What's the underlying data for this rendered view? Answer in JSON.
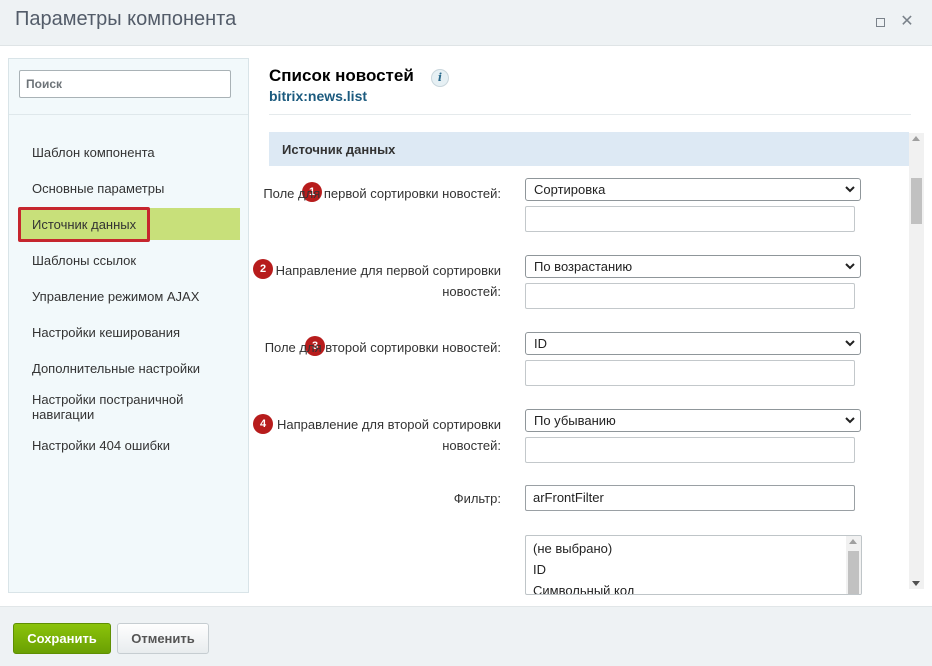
{
  "window": {
    "title": "Параметры компонента"
  },
  "sidebar": {
    "search_placeholder": "Поиск",
    "items": [
      {
        "label": "Шаблон компонента"
      },
      {
        "label": "Основные параметры"
      },
      {
        "label": "Источник данных",
        "active": true
      },
      {
        "label": "Шаблоны ссылок"
      },
      {
        "label": "Управление режимом AJAX"
      },
      {
        "label": "Настройки кеширования"
      },
      {
        "label": "Дополнительные настройки"
      },
      {
        "label": "Настройки постраничной навигации"
      },
      {
        "label": "Настройки 404 ошибки"
      }
    ]
  },
  "component": {
    "title": "Список новостей",
    "code": "bitrix:news.list",
    "info_icon": "info-icon"
  },
  "section": {
    "title": "Источник данных"
  },
  "fields": [
    {
      "badge": "1",
      "label": "Поле для первой сортировки новостей:",
      "select_value": "Сортировка",
      "text_value": ""
    },
    {
      "badge": "2",
      "label": "Направление для первой сортировки новостей:",
      "select_value": "По возрастанию",
      "text_value": ""
    },
    {
      "badge": "3",
      "label": "Поле для второй сортировки новостей:",
      "select_value": "ID",
      "text_value": ""
    },
    {
      "badge": "4",
      "label": "Направление для второй сортировки новостей:",
      "select_value": "По убыванию",
      "text_value": ""
    }
  ],
  "filter": {
    "label": "Фильтр:",
    "value": "arFrontFilter"
  },
  "multi_select": {
    "options": [
      "(не выбрано)",
      "ID",
      "Символьный код"
    ]
  },
  "footer": {
    "save_label": "Сохранить",
    "cancel_label": "Отменить"
  },
  "colors": {
    "active_nav": "#c8e07a",
    "highlight_frame": "#c6262e",
    "badge": "#b71c1c",
    "section_header": "#dde9f4",
    "save_button": "#7ab106"
  }
}
